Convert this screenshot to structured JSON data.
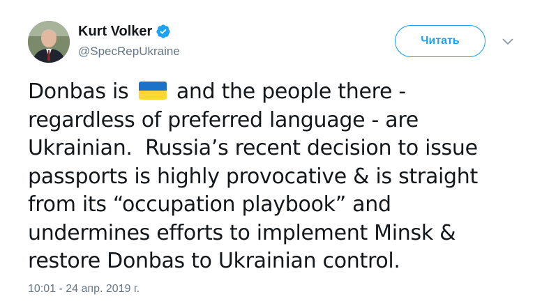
{
  "author": {
    "display_name": "Kurt Volker",
    "handle": "@SpecRepUkraine",
    "verified": true,
    "avatar_icon": "portrait-avatar"
  },
  "actions": {
    "follow_label": "Читать",
    "more_icon": "chevron-down-icon"
  },
  "tweet": {
    "line1_before_flag": "Donbas is",
    "flag_icon": "ukraine-flag-emoji",
    "line1_after_flag": "and the people there -",
    "line2": "regardless of preferred language - are",
    "line3": "Ukrainian.  Russia’s recent decision to issue",
    "line4": "passports is highly provocative & is straight",
    "line5": "from its “occupation playbook” and",
    "line6": "undermines efforts to implement Minsk &",
    "line7": "restore Donbas to Ukrainian control.",
    "timestamp": "10:01 - 24 апр. 2019 г."
  },
  "colors": {
    "accent": "#1da1f2",
    "secondary_text": "#657786",
    "primary_text": "#14171a",
    "flag_blue": "#0057b7",
    "flag_yellow": "#ffd700"
  }
}
